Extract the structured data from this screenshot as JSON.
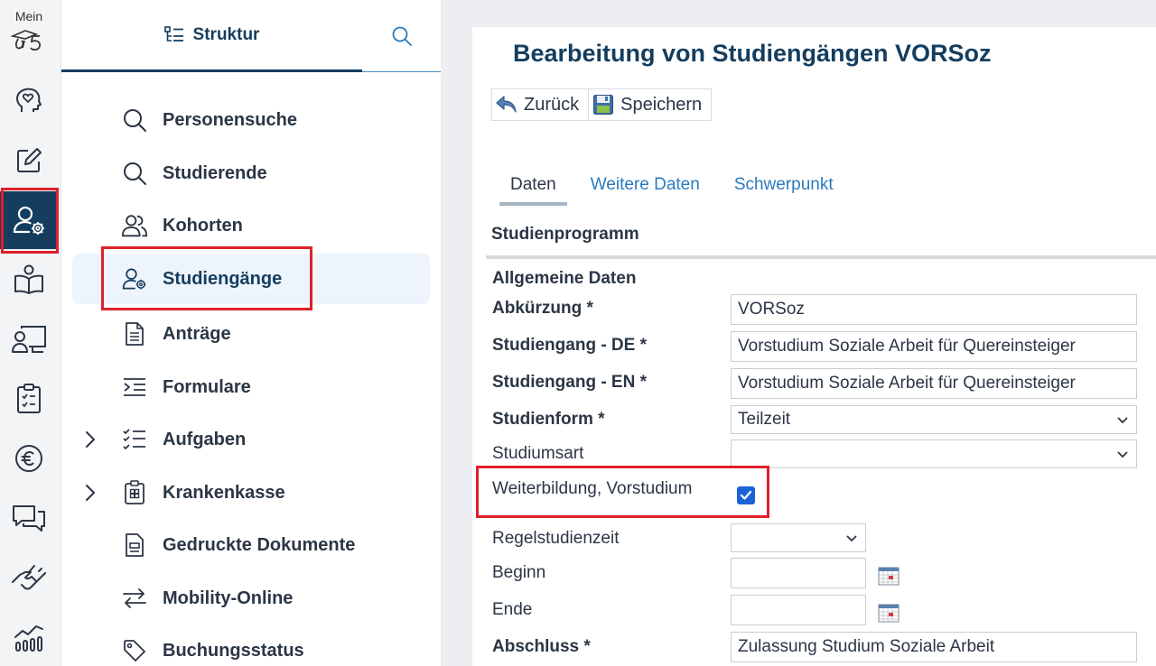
{
  "rail": {
    "brand_label": "Mein",
    "items": [
      {
        "icon": "head-heart-icon"
      },
      {
        "icon": "edit-icon"
      },
      {
        "icon": "user-settings-icon",
        "active": true
      },
      {
        "icon": "book-reader-icon"
      },
      {
        "icon": "user-board-icon"
      },
      {
        "icon": "clipboard-list-icon"
      },
      {
        "icon": "euro-icon"
      },
      {
        "icon": "chat-icon"
      },
      {
        "icon": "handshake-icon"
      },
      {
        "icon": "chart-icon"
      }
    ]
  },
  "nav": {
    "tab_struktur": "Struktur",
    "items": [
      {
        "label": "Personensuche",
        "icon": "search-icon"
      },
      {
        "label": "Studierende",
        "icon": "search-icon"
      },
      {
        "label": "Kohorten",
        "icon": "users-icon"
      },
      {
        "label": "Studiengänge",
        "icon": "user-settings-icon",
        "selected": true
      },
      {
        "label": "Anträge",
        "icon": "document-icon"
      },
      {
        "label": "Formulare",
        "icon": "form-list-icon"
      },
      {
        "label": "Aufgaben",
        "icon": "checklist-icon",
        "expandable": true
      },
      {
        "label": "Krankenkasse",
        "icon": "medical-clipboard-icon",
        "expandable": true
      },
      {
        "label": "Gedruckte Dokumente",
        "icon": "printed-doc-icon"
      },
      {
        "label": "Mobility-Online",
        "icon": "exchange-icon"
      },
      {
        "label": "Buchungsstatus",
        "icon": "tag-icon"
      }
    ]
  },
  "content": {
    "title": "Bearbeitung von Studiengängen VORSoz",
    "toolbar": {
      "back": "Zurück",
      "save": "Speichern"
    },
    "tabs": [
      "Daten",
      "Weitere Daten",
      "Schwerpunkt"
    ],
    "section_title": "Studienprogramm",
    "group_title": "Allgemeine Daten",
    "fields": {
      "abkuerzung": {
        "label": "Abkürzung *",
        "value": "VORSoz"
      },
      "studiengang_de": {
        "label": "Studiengang - DE *",
        "value": "Vorstudium Soziale Arbeit für Quereinsteiger"
      },
      "studiengang_en": {
        "label": "Studiengang - EN *",
        "value": "Vorstudium Soziale Arbeit für Quereinsteiger"
      },
      "studienform": {
        "label": "Studienform *",
        "value": "Teilzeit"
      },
      "studiumsart": {
        "label": "Studiumsart",
        "value": ""
      },
      "weiterbildung": {
        "label": "Weiterbildung, Vorstudium",
        "checked": true
      },
      "regelstudienzeit": {
        "label": "Regelstudienzeit",
        "value": ""
      },
      "beginn": {
        "label": "Beginn",
        "value": ""
      },
      "ende": {
        "label": "Ende",
        "value": ""
      },
      "abschluss": {
        "label": "Abschluss *",
        "value": "Zulassung Studium Soziale Arbeit"
      }
    }
  },
  "colors": {
    "brand": "#143d5e",
    "link": "#2a7bbf",
    "highlight": "#e0202a",
    "checkbox": "#1a62d6"
  }
}
